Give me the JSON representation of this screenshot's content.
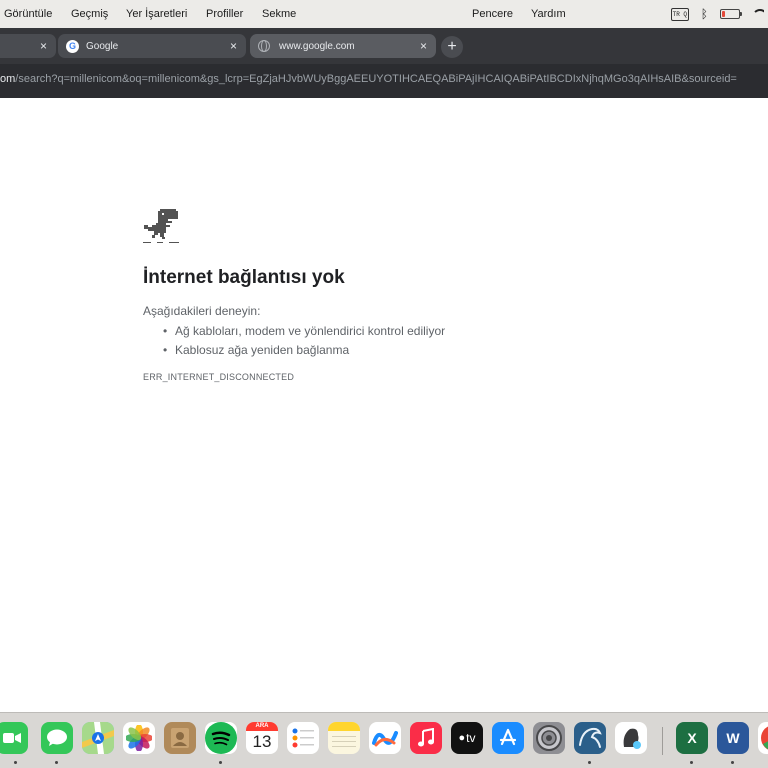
{
  "menubar": {
    "items": [
      "Görüntüle",
      "Geçmiş",
      "Yer İşaretleri",
      "Profiller",
      "Sekme",
      "Pencere",
      "Yardım"
    ],
    "keyboard_label": "TR Q",
    "battery_level": 0.2,
    "battery_color": "#e34a3a"
  },
  "tabs": [
    {
      "title": "",
      "icon": "none",
      "active": false
    },
    {
      "title": "Google",
      "icon": "google-favicon",
      "active": false
    },
    {
      "title": "www.google.com",
      "icon": "globe-icon",
      "active": true
    }
  ],
  "new_tab_symbol": "+",
  "close_symbol": "×",
  "address_bar": {
    "host_fragment": "om",
    "path": "/search?q=millenicom&oq=millenicom&gs_lcrp=EgZjaHJvbWUyBggAEEUYOTIHCAEQABiPAjIHCAIQABiPAtIBCDIxNjhqMGo3qAIHsAIB&sourceid="
  },
  "error_page": {
    "title": "İnternet bağlantısı yok",
    "try_label": "Aşağıdakileri deneyin:",
    "suggestions": [
      "Ağ kabloları, modem ve yönlendirici kontrol ediliyor",
      "Kablosuz ağa yeniden bağlanma"
    ],
    "error_code": "ERR_INTERNET_DISCONNECTED"
  },
  "dock": {
    "calendar_month": "ARA",
    "calendar_day": "13",
    "tv_label": "tv",
    "excel_letter": "X",
    "word_letter": "W",
    "apps": [
      {
        "name": "facetime-icon",
        "color": "#34c759"
      },
      {
        "name": "messages-icon",
        "color": "#34c759"
      },
      {
        "name": "maps-icon",
        "color": "#5ac8fa"
      },
      {
        "name": "photos-icon",
        "color": "#ffffff"
      },
      {
        "name": "contacts-icon",
        "color": "#b08a5a"
      },
      {
        "name": "spotify-icon",
        "color": "#1db954"
      },
      {
        "name": "calendar-icon",
        "color": "#ffffff"
      },
      {
        "name": "reminders-icon",
        "color": "#ffffff"
      },
      {
        "name": "notes-icon",
        "color": "#ffd52e"
      },
      {
        "name": "freeform-icon",
        "color": "#ffffff"
      },
      {
        "name": "music-icon",
        "color": "#fa2d48"
      },
      {
        "name": "apple-tv-icon",
        "color": "#111111"
      },
      {
        "name": "app-store-icon",
        "color": "#1a8cff"
      },
      {
        "name": "system-settings-icon",
        "color": "#8e8e93"
      },
      {
        "name": "mysql-workbench-icon",
        "color": "#2b5f8a"
      },
      {
        "name": "sequel-ace-icon",
        "color": "#ffffff"
      },
      {
        "name": "excel-icon",
        "color": "#1d6f42"
      },
      {
        "name": "word-icon",
        "color": "#2b579a"
      },
      {
        "name": "chrome-icon",
        "color": "#ffffff"
      }
    ]
  }
}
